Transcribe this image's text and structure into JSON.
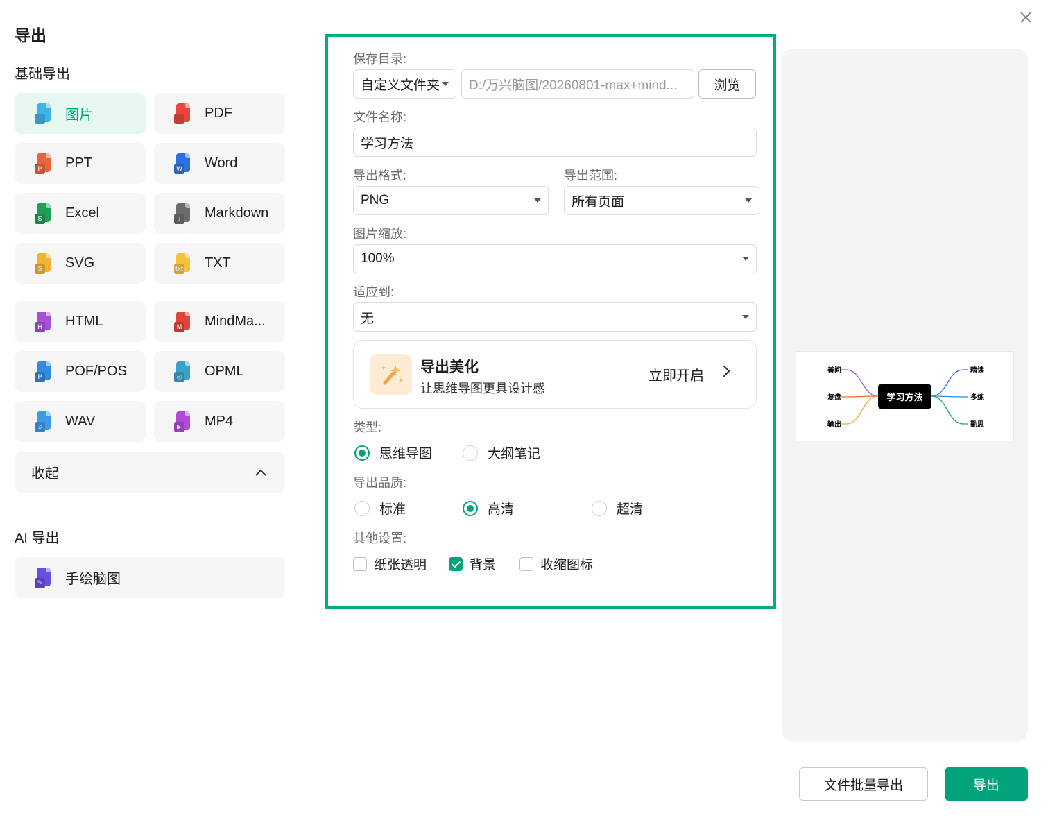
{
  "sidebar": {
    "title": "导出",
    "basic_section": "基础导出",
    "ai_section": "AI 导出",
    "formats": [
      {
        "label": "图片",
        "icon": "image-file-icon",
        "color": "#3fb3e8",
        "badge": ""
      },
      {
        "label": "PDF",
        "icon": "pdf-file-icon",
        "color": "#e8453c",
        "badge": ""
      },
      {
        "label": "PPT",
        "icon": "ppt-file-icon",
        "color": "#e8643c",
        "badge": "P"
      },
      {
        "label": "Word",
        "icon": "word-file-icon",
        "color": "#2f6fe0",
        "badge": "W"
      },
      {
        "label": "Excel",
        "icon": "excel-file-icon",
        "color": "#1f9e55",
        "badge": "S"
      },
      {
        "label": "Markdown",
        "icon": "markdown-file-icon",
        "color": "#6b6b6b",
        "badge": "↓"
      },
      {
        "label": "SVG",
        "icon": "svg-file-icon",
        "color": "#f2b233",
        "badge": "S"
      },
      {
        "label": "TXT",
        "icon": "txt-file-icon",
        "color": "#f5c23a",
        "badge": "txt"
      },
      {
        "label": "HTML",
        "icon": "html-file-icon",
        "color": "#a54fd6",
        "badge": "H"
      },
      {
        "label": "MindMa...",
        "icon": "mindmanager-file-icon",
        "color": "#e0443a",
        "badge": "M"
      },
      {
        "label": "POF/POS",
        "icon": "pof-file-icon",
        "color": "#2f8ae0",
        "badge": "P"
      },
      {
        "label": "OPML",
        "icon": "opml-file-icon",
        "color": "#3aa0c8",
        "badge": "◎"
      },
      {
        "label": "WAV",
        "icon": "wav-file-icon",
        "color": "#3b9be6",
        "badge": "♫"
      },
      {
        "label": "MP4",
        "icon": "mp4-file-icon",
        "color": "#b04ad8",
        "badge": "▶"
      }
    ],
    "collapse_label": "收起",
    "ai_formats": [
      {
        "label": "手绘脑图",
        "icon": "hand-drawn-mindmap-icon",
        "color": "#6b4de0",
        "badge": "✎"
      }
    ]
  },
  "form": {
    "save_dir_label": "保存目录:",
    "folder_mode": "自定义文件夹",
    "path": "D:/万兴脑图/20260801-max+mind...",
    "browse": "浏览",
    "filename_label": "文件名称:",
    "filename": "学习方法",
    "format_label": "导出格式:",
    "format": "PNG",
    "range_label": "导出范围:",
    "range": "所有页面",
    "scale_label": "图片缩放:",
    "scale": "100%",
    "fit_label": "适应到:",
    "fit": "无",
    "beautify": {
      "title": "导出美化",
      "subtitle": "让思维导图更具设计感",
      "cta": "立即开启"
    },
    "type_label": "类型:",
    "type_options": [
      "思维导图",
      "大纲笔记"
    ],
    "type_selected": 0,
    "quality_label": "导出品质:",
    "quality_options": [
      "标准",
      "高清",
      "超清"
    ],
    "quality_selected": 1,
    "other_label": "其他设置:",
    "other_options": [
      {
        "label": "纸张透明",
        "checked": false
      },
      {
        "label": "背景",
        "checked": true
      },
      {
        "label": "收缩图标",
        "checked": false
      }
    ]
  },
  "preview": {
    "center": "学习方法",
    "left": [
      "善问",
      "复盘",
      "输出"
    ],
    "right": [
      "精读",
      "多练",
      "勤思"
    ],
    "branch_colors": [
      "#8b5cf6",
      "#ef6c3a",
      "#f2a93b",
      "#3b6fe0",
      "#2f8ae0",
      "#22a56b"
    ]
  },
  "actions": {
    "batch": "文件批量导出",
    "export": "导出"
  },
  "colors": {
    "accent": "#00a37a",
    "highlight_border": "#00b07c",
    "active_bg": "#e6f6f0"
  }
}
